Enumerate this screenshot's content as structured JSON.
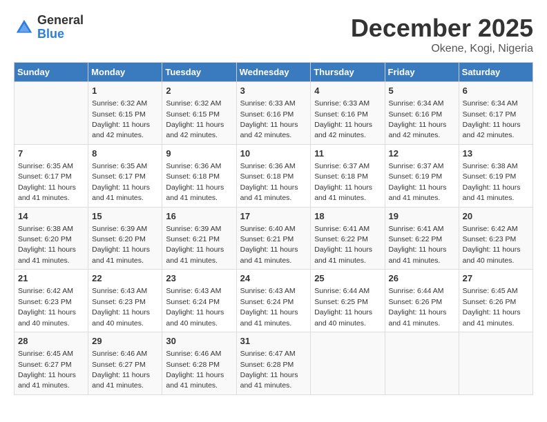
{
  "header": {
    "logo": {
      "general": "General",
      "blue": "Blue"
    },
    "title": "December 2025",
    "location": "Okene, Kogi, Nigeria"
  },
  "calendar": {
    "days_of_week": [
      "Sunday",
      "Monday",
      "Tuesday",
      "Wednesday",
      "Thursday",
      "Friday",
      "Saturday"
    ],
    "weeks": [
      [
        {
          "day": "",
          "sunrise": "",
          "sunset": "",
          "daylight": ""
        },
        {
          "day": "1",
          "sunrise": "Sunrise: 6:32 AM",
          "sunset": "Sunset: 6:15 PM",
          "daylight": "Daylight: 11 hours and 42 minutes."
        },
        {
          "day": "2",
          "sunrise": "Sunrise: 6:32 AM",
          "sunset": "Sunset: 6:15 PM",
          "daylight": "Daylight: 11 hours and 42 minutes."
        },
        {
          "day": "3",
          "sunrise": "Sunrise: 6:33 AM",
          "sunset": "Sunset: 6:16 PM",
          "daylight": "Daylight: 11 hours and 42 minutes."
        },
        {
          "day": "4",
          "sunrise": "Sunrise: 6:33 AM",
          "sunset": "Sunset: 6:16 PM",
          "daylight": "Daylight: 11 hours and 42 minutes."
        },
        {
          "day": "5",
          "sunrise": "Sunrise: 6:34 AM",
          "sunset": "Sunset: 6:16 PM",
          "daylight": "Daylight: 11 hours and 42 minutes."
        },
        {
          "day": "6",
          "sunrise": "Sunrise: 6:34 AM",
          "sunset": "Sunset: 6:17 PM",
          "daylight": "Daylight: 11 hours and 42 minutes."
        }
      ],
      [
        {
          "day": "7",
          "sunrise": "Sunrise: 6:35 AM",
          "sunset": "Sunset: 6:17 PM",
          "daylight": "Daylight: 11 hours and 41 minutes."
        },
        {
          "day": "8",
          "sunrise": "Sunrise: 6:35 AM",
          "sunset": "Sunset: 6:17 PM",
          "daylight": "Daylight: 11 hours and 41 minutes."
        },
        {
          "day": "9",
          "sunrise": "Sunrise: 6:36 AM",
          "sunset": "Sunset: 6:18 PM",
          "daylight": "Daylight: 11 hours and 41 minutes."
        },
        {
          "day": "10",
          "sunrise": "Sunrise: 6:36 AM",
          "sunset": "Sunset: 6:18 PM",
          "daylight": "Daylight: 11 hours and 41 minutes."
        },
        {
          "day": "11",
          "sunrise": "Sunrise: 6:37 AM",
          "sunset": "Sunset: 6:18 PM",
          "daylight": "Daylight: 11 hours and 41 minutes."
        },
        {
          "day": "12",
          "sunrise": "Sunrise: 6:37 AM",
          "sunset": "Sunset: 6:19 PM",
          "daylight": "Daylight: 11 hours and 41 minutes."
        },
        {
          "day": "13",
          "sunrise": "Sunrise: 6:38 AM",
          "sunset": "Sunset: 6:19 PM",
          "daylight": "Daylight: 11 hours and 41 minutes."
        }
      ],
      [
        {
          "day": "14",
          "sunrise": "Sunrise: 6:38 AM",
          "sunset": "Sunset: 6:20 PM",
          "daylight": "Daylight: 11 hours and 41 minutes."
        },
        {
          "day": "15",
          "sunrise": "Sunrise: 6:39 AM",
          "sunset": "Sunset: 6:20 PM",
          "daylight": "Daylight: 11 hours and 41 minutes."
        },
        {
          "day": "16",
          "sunrise": "Sunrise: 6:39 AM",
          "sunset": "Sunset: 6:21 PM",
          "daylight": "Daylight: 11 hours and 41 minutes."
        },
        {
          "day": "17",
          "sunrise": "Sunrise: 6:40 AM",
          "sunset": "Sunset: 6:21 PM",
          "daylight": "Daylight: 11 hours and 41 minutes."
        },
        {
          "day": "18",
          "sunrise": "Sunrise: 6:41 AM",
          "sunset": "Sunset: 6:22 PM",
          "daylight": "Daylight: 11 hours and 41 minutes."
        },
        {
          "day": "19",
          "sunrise": "Sunrise: 6:41 AM",
          "sunset": "Sunset: 6:22 PM",
          "daylight": "Daylight: 11 hours and 41 minutes."
        },
        {
          "day": "20",
          "sunrise": "Sunrise: 6:42 AM",
          "sunset": "Sunset: 6:23 PM",
          "daylight": "Daylight: 11 hours and 40 minutes."
        }
      ],
      [
        {
          "day": "21",
          "sunrise": "Sunrise: 6:42 AM",
          "sunset": "Sunset: 6:23 PM",
          "daylight": "Daylight: 11 hours and 40 minutes."
        },
        {
          "day": "22",
          "sunrise": "Sunrise: 6:43 AM",
          "sunset": "Sunset: 6:23 PM",
          "daylight": "Daylight: 11 hours and 40 minutes."
        },
        {
          "day": "23",
          "sunrise": "Sunrise: 6:43 AM",
          "sunset": "Sunset: 6:24 PM",
          "daylight": "Daylight: 11 hours and 40 minutes."
        },
        {
          "day": "24",
          "sunrise": "Sunrise: 6:43 AM",
          "sunset": "Sunset: 6:24 PM",
          "daylight": "Daylight: 11 hours and 41 minutes."
        },
        {
          "day": "25",
          "sunrise": "Sunrise: 6:44 AM",
          "sunset": "Sunset: 6:25 PM",
          "daylight": "Daylight: 11 hours and 40 minutes."
        },
        {
          "day": "26",
          "sunrise": "Sunrise: 6:44 AM",
          "sunset": "Sunset: 6:26 PM",
          "daylight": "Daylight: 11 hours and 41 minutes."
        },
        {
          "day": "27",
          "sunrise": "Sunrise: 6:45 AM",
          "sunset": "Sunset: 6:26 PM",
          "daylight": "Daylight: 11 hours and 41 minutes."
        }
      ],
      [
        {
          "day": "28",
          "sunrise": "Sunrise: 6:45 AM",
          "sunset": "Sunset: 6:27 PM",
          "daylight": "Daylight: 11 hours and 41 minutes."
        },
        {
          "day": "29",
          "sunrise": "Sunrise: 6:46 AM",
          "sunset": "Sunset: 6:27 PM",
          "daylight": "Daylight: 11 hours and 41 minutes."
        },
        {
          "day": "30",
          "sunrise": "Sunrise: 6:46 AM",
          "sunset": "Sunset: 6:28 PM",
          "daylight": "Daylight: 11 hours and 41 minutes."
        },
        {
          "day": "31",
          "sunrise": "Sunrise: 6:47 AM",
          "sunset": "Sunset: 6:28 PM",
          "daylight": "Daylight: 11 hours and 41 minutes."
        },
        {
          "day": "",
          "sunrise": "",
          "sunset": "",
          "daylight": ""
        },
        {
          "day": "",
          "sunrise": "",
          "sunset": "",
          "daylight": ""
        },
        {
          "day": "",
          "sunrise": "",
          "sunset": "",
          "daylight": ""
        }
      ]
    ]
  }
}
